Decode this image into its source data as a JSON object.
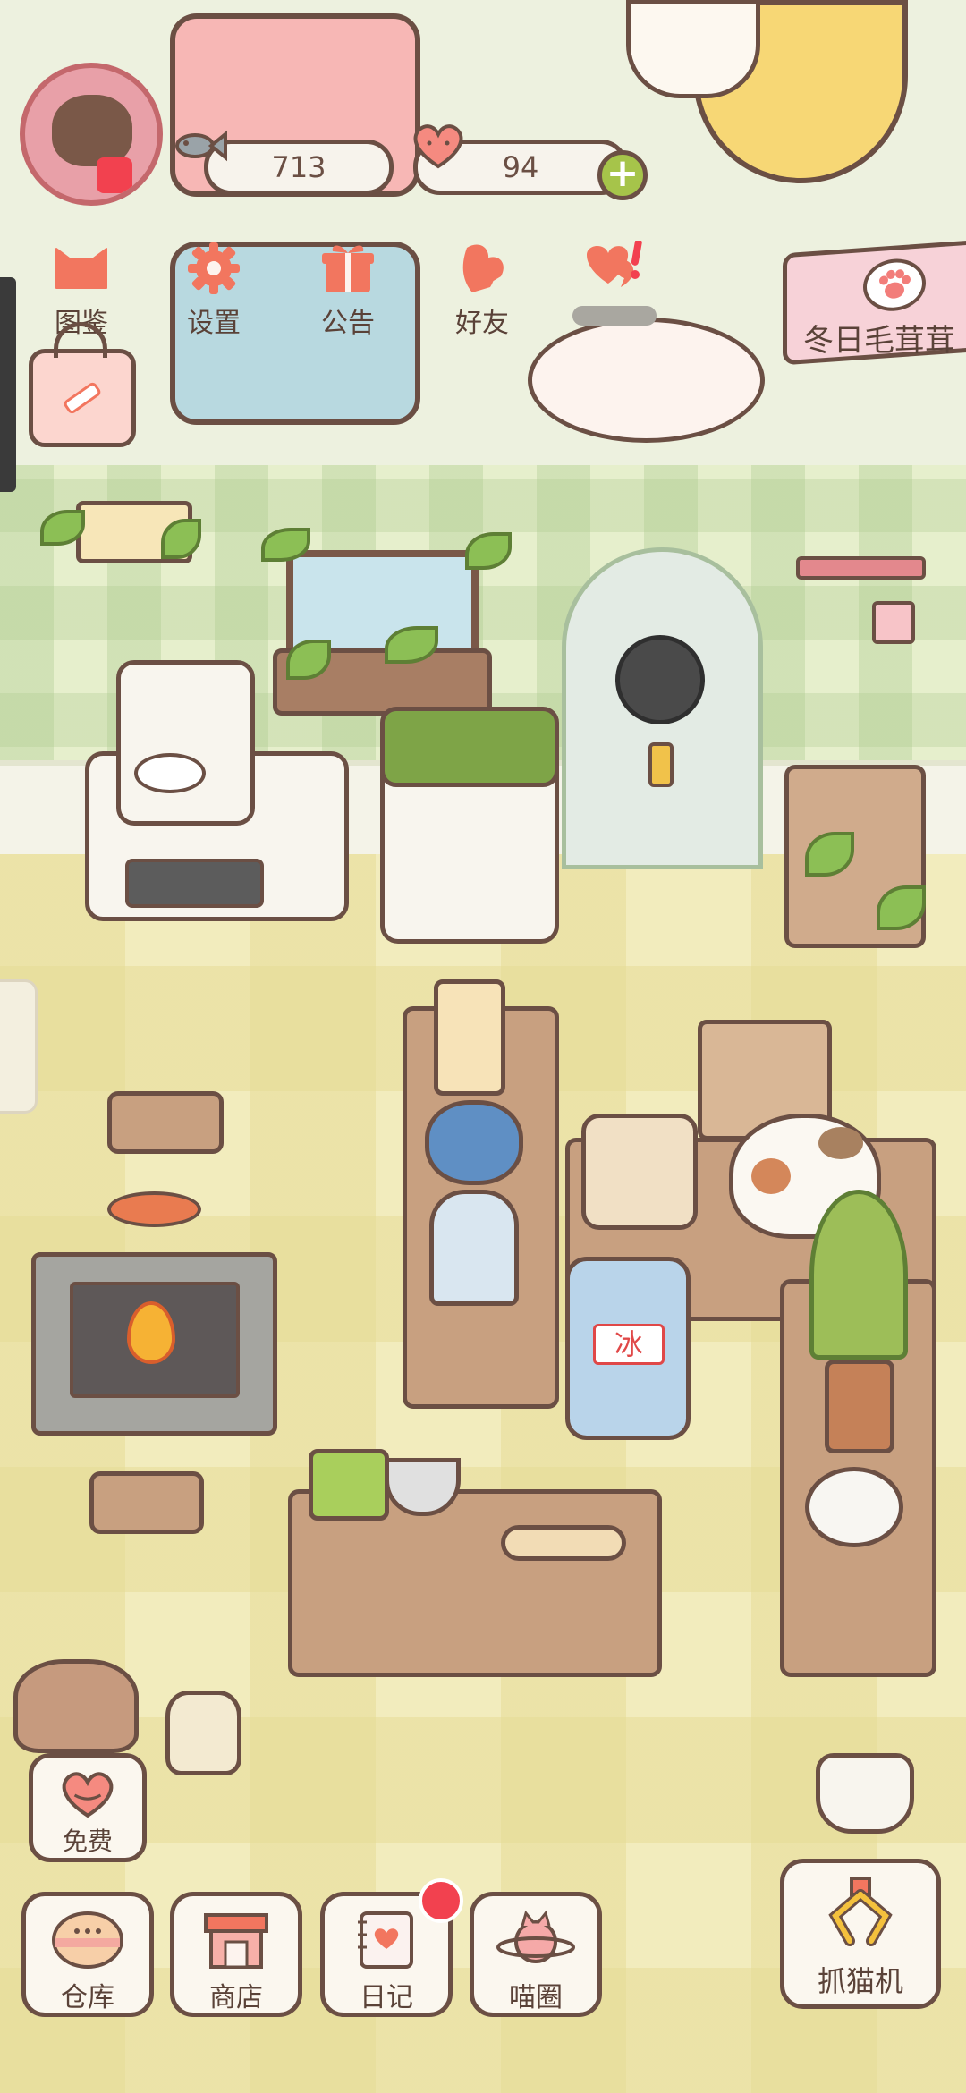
{
  "resources": {
    "fish": {
      "icon": "fish-icon",
      "value": "713"
    },
    "hearts": {
      "icon": "heart-icon",
      "value": "94"
    }
  },
  "top_menu": [
    {
      "id": "handbook",
      "icon": "cat-head-icon",
      "label": "图鉴"
    },
    {
      "id": "settings",
      "icon": "gear-icon",
      "label": "设置"
    },
    {
      "id": "notice",
      "icon": "gift-icon",
      "label": "公告"
    },
    {
      "id": "friends",
      "icon": "friends-icon",
      "label": "好友"
    },
    {
      "id": "messages",
      "icon": "message-icon",
      "label": ""
    }
  ],
  "event_banner": {
    "label": "冬日毛茸茸",
    "icon": "paw-icon"
  },
  "free": {
    "label": "免费",
    "icon": "heart-icon"
  },
  "bottom_bar": [
    {
      "id": "storage",
      "icon": "bowl-icon",
      "label": "仓库"
    },
    {
      "id": "shop",
      "icon": "shop-icon",
      "label": "商店"
    },
    {
      "id": "diary",
      "icon": "diary-icon",
      "label": "日记"
    },
    {
      "id": "circle",
      "icon": "planet-icon",
      "label": "喵圈"
    }
  ],
  "claw_machine": {
    "label": "抓猫机",
    "icon": "claw-icon"
  },
  "scene_items": {
    "ice_sign": "冰"
  },
  "colors": {
    "outline": "#6b4f44",
    "accent_pink": "#f2765f",
    "badge_red": "#f2414f",
    "plus_green": "#a6c44a"
  }
}
